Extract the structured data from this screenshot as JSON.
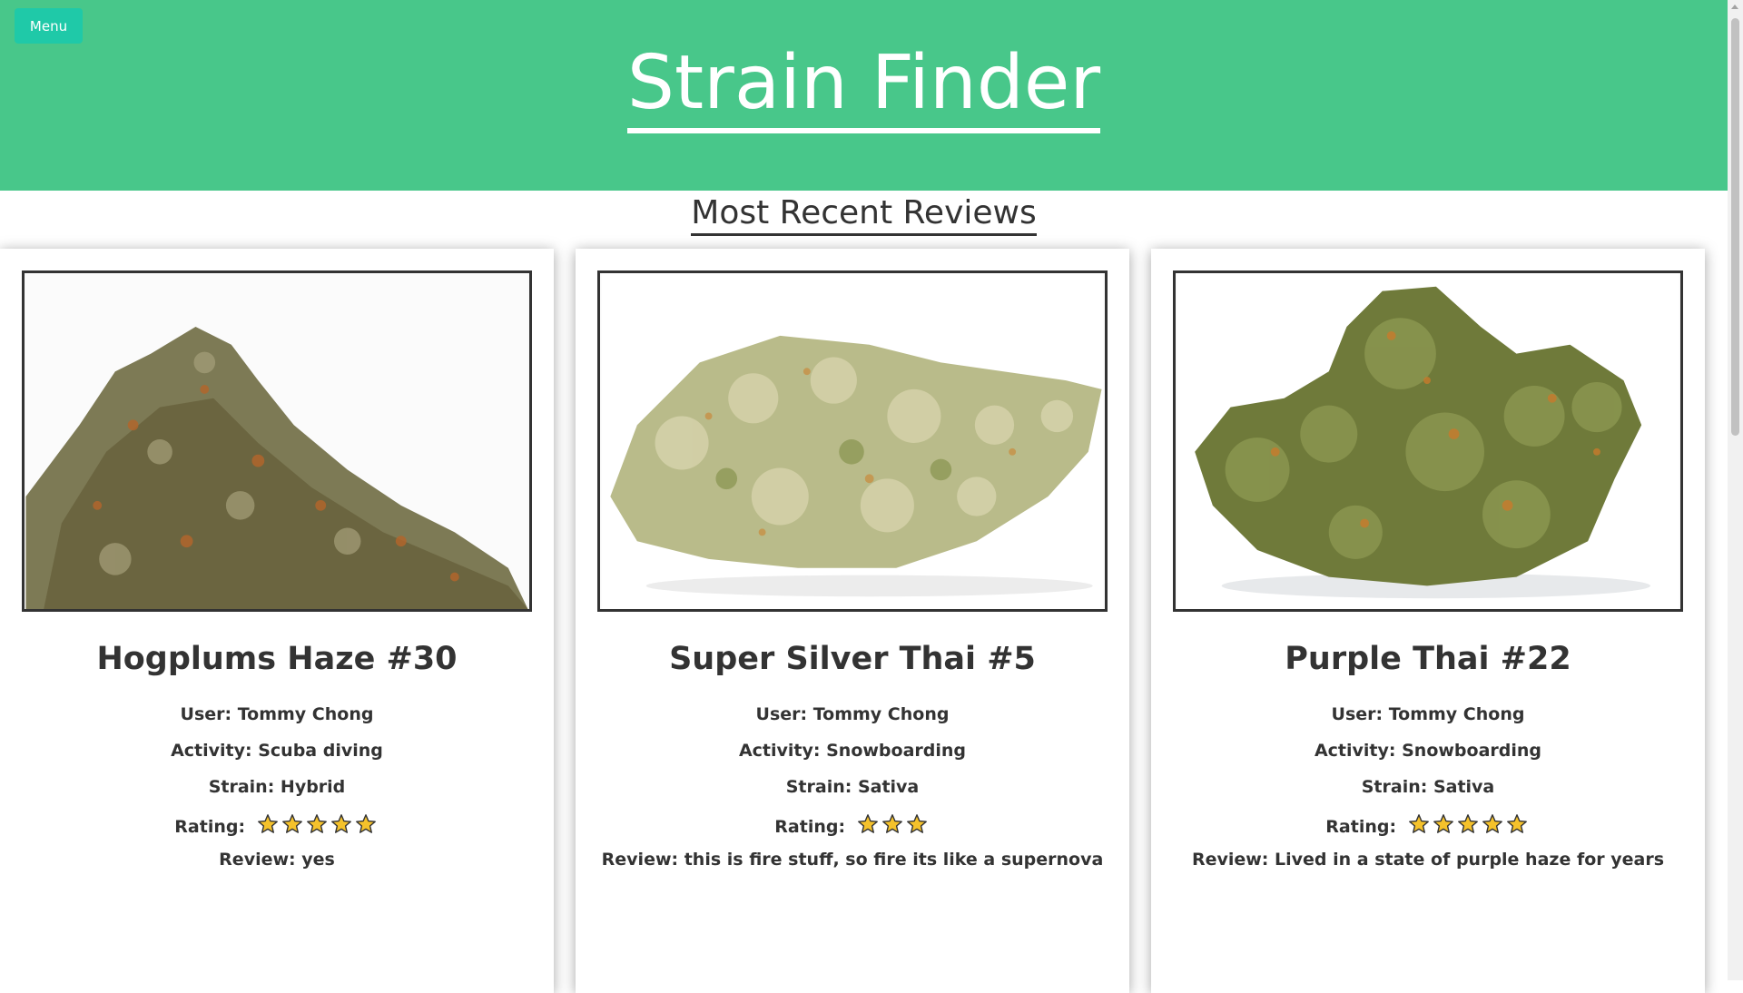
{
  "header": {
    "menu_label": "Menu",
    "title": "Strain Finder",
    "bg_color": "#48c78a",
    "menu_color": "#1fc9a8"
  },
  "section": {
    "title": "Most Recent Reviews"
  },
  "reviews": [
    {
      "name": "Hogplums Haze #30",
      "user": "User: Tommy Chong",
      "activity": "Activity: Scuba diving",
      "strain": "Strain: Hybrid",
      "rating_label": "Rating:",
      "rating": 5,
      "review": "Review: yes",
      "image_icon": "cannabis-bud-image"
    },
    {
      "name": "Super Silver Thai #5",
      "user": "User: Tommy Chong",
      "activity": "Activity: Snowboarding",
      "strain": "Strain: Sativa",
      "rating_label": "Rating:",
      "rating": 3,
      "review": "Review: this is fire stuff, so fire its like a supernova",
      "image_icon": "cannabis-bud-image"
    },
    {
      "name": "Purple Thai #22",
      "user": "User: Tommy Chong",
      "activity": "Activity: Snowboarding",
      "strain": "Strain: Sativa",
      "rating_label": "Rating:",
      "rating": 5,
      "review": "Review: Lived in a state of purple haze for years",
      "image_icon": "cannabis-bud-image"
    }
  ],
  "star_color": "#f5c22b"
}
